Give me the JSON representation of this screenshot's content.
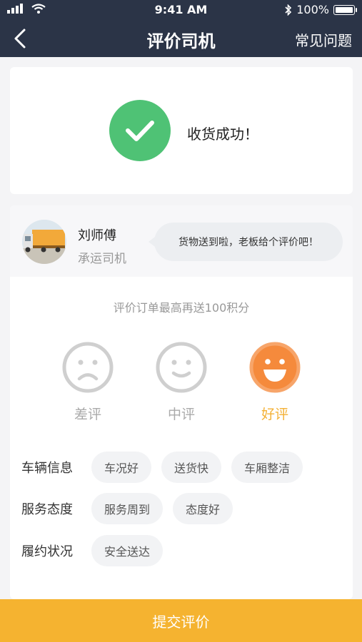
{
  "status_bar": {
    "time": "9:41 AM",
    "battery_text": "100%"
  },
  "nav": {
    "title": "评价司机",
    "faq_label": "常见问题"
  },
  "success": {
    "message": "收货成功！"
  },
  "driver": {
    "name": "刘师傅",
    "role": "承运司机",
    "bubble_text": "货物送到啦，老板给个评价吧！"
  },
  "bonus_note": "评价订单最高再送100积分",
  "ratings": [
    {
      "label": "差评",
      "selected": false
    },
    {
      "label": "中评",
      "selected": false
    },
    {
      "label": "好评",
      "selected": true
    }
  ],
  "tag_groups": [
    {
      "title": "车辆信息",
      "tags": [
        "车况好",
        "送货快",
        "车厢整洁"
      ]
    },
    {
      "title": "服务态度",
      "tags": [
        "服务周到",
        "态度好"
      ]
    },
    {
      "title": "履约状况",
      "tags": [
        "安全送达"
      ]
    }
  ],
  "submit_label": "提交评价",
  "colors": {
    "header": "#2b3447",
    "success_green": "#4fc275",
    "accent_orange": "#f4b135",
    "good_face": "#f58a3c",
    "submit": "#f5b330"
  },
  "icons": {
    "back": "chevron-left-icon",
    "check": "check-icon",
    "bad": "sad-face-icon",
    "mid": "neutral-face-icon",
    "good": "happy-face-icon"
  }
}
